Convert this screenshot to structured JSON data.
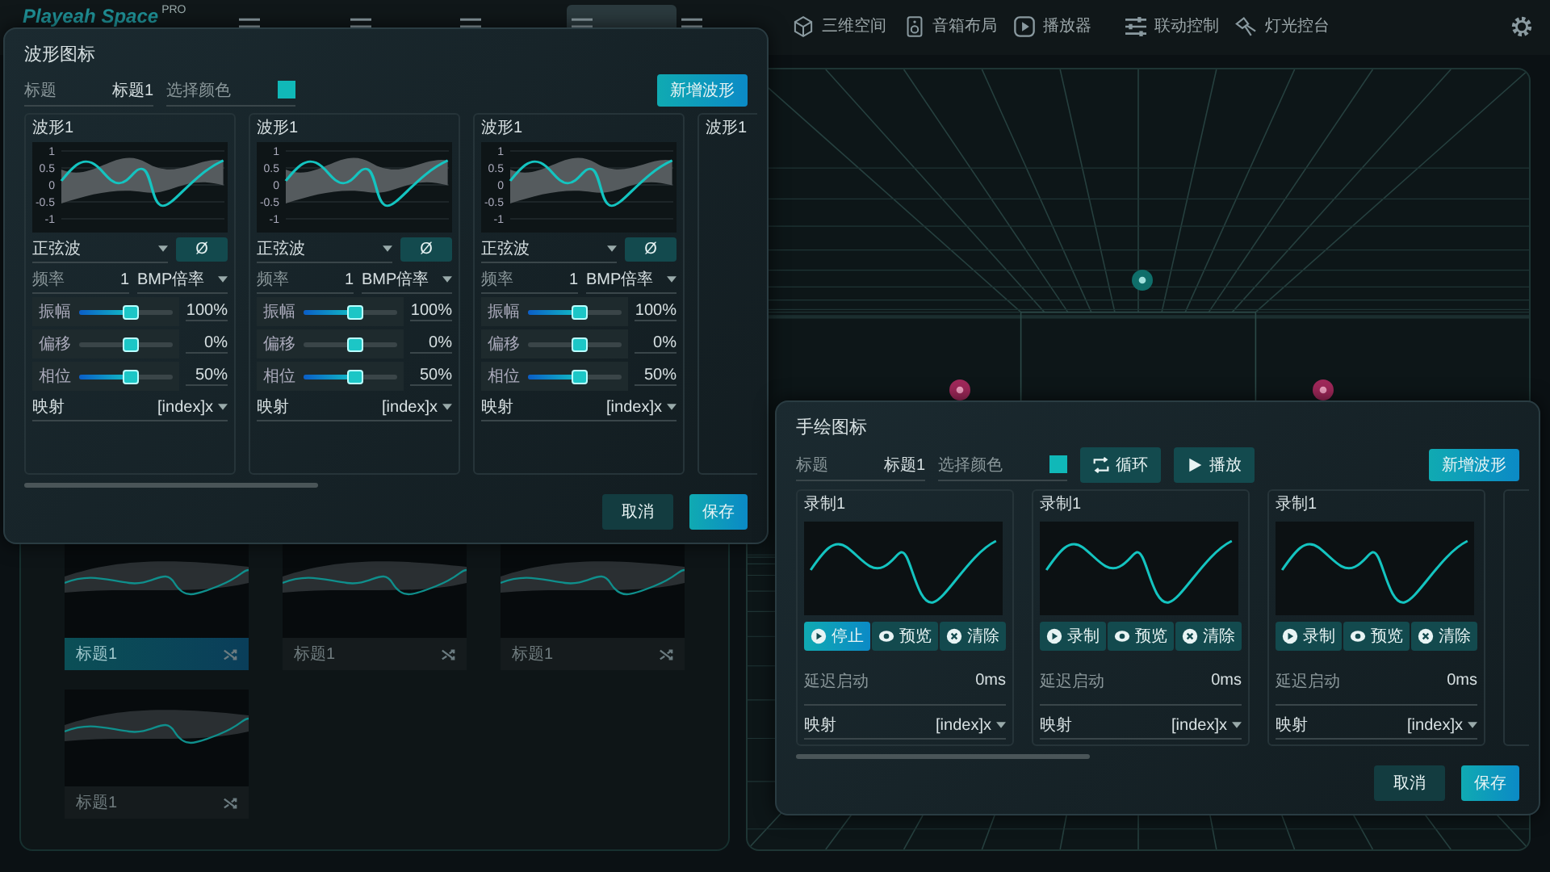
{
  "top_bar": {
    "logo": "Playeah Space",
    "logo_badge": "PRO",
    "nav": [
      {
        "selected": false
      },
      {
        "selected": false
      },
      {
        "selected": false
      },
      {
        "selected": true
      },
      {
        "selected": false
      },
      {
        "label": "三维空间",
        "selected": false
      },
      {
        "label": "音箱布局",
        "selected": false
      },
      {
        "label": "播放器",
        "selected": false
      },
      {
        "label": "联动控制",
        "selected": false
      },
      {
        "label": "灯光控台",
        "selected": false
      }
    ]
  },
  "library": {
    "items": [
      {
        "title": "标题1",
        "selected": true
      },
      {
        "title": "标题1",
        "selected": false
      },
      {
        "title": "标题1",
        "selected": false
      },
      {
        "title": "标题1",
        "selected": false
      }
    ]
  },
  "wave_dialog": {
    "title": "波形图标",
    "title_field": {
      "label": "标题",
      "value": "标题1"
    },
    "color_field": {
      "label": "选择颜色",
      "color": "#10b8b8"
    },
    "add_button": "新增波形",
    "cards": [
      {
        "title": "波形1",
        "yticks": [
          "1",
          "0.5",
          "0",
          "-0.5",
          "-1"
        ],
        "wave_type": "正弦波",
        "invert_button": "Ø",
        "freq_label": "频率",
        "freq_value": "1",
        "freq_mode": "BMP倍率",
        "sliders": [
          {
            "label": "振幅",
            "level": 0.55,
            "kind": "fill",
            "reading": "100%"
          },
          {
            "label": "偏移",
            "level": 0.55,
            "kind": "centered",
            "reading": "0%"
          },
          {
            "label": "相位",
            "level": 0.55,
            "kind": "fill",
            "reading": "50%"
          }
        ],
        "map_label": "映射",
        "map_value": "[index]x"
      },
      {
        "title": "波形1",
        "yticks": [
          "1",
          "0.5",
          "0",
          "-0.5",
          "-1"
        ],
        "wave_type": "正弦波",
        "invert_button": "Ø",
        "freq_label": "频率",
        "freq_value": "1",
        "freq_mode": "BMP倍率",
        "sliders": [
          {
            "label": "振幅",
            "level": 0.55,
            "kind": "fill",
            "reading": "100%"
          },
          {
            "label": "偏移",
            "level": 0.55,
            "kind": "centered",
            "reading": "0%"
          },
          {
            "label": "相位",
            "level": 0.55,
            "kind": "fill",
            "reading": "50%"
          }
        ],
        "map_label": "映射",
        "map_value": "[index]x"
      },
      {
        "title": "波形1",
        "yticks": [
          "1",
          "0.5",
          "0",
          "-0.5",
          "-1"
        ],
        "wave_type": "正弦波",
        "invert_button": "Ø",
        "freq_label": "频率",
        "freq_value": "1",
        "freq_mode": "BMP倍率",
        "sliders": [
          {
            "label": "振幅",
            "level": 0.55,
            "kind": "fill",
            "reading": "100%"
          },
          {
            "label": "偏移",
            "level": 0.55,
            "kind": "centered",
            "reading": "0%"
          },
          {
            "label": "相位",
            "level": 0.55,
            "kind": "fill",
            "reading": "50%"
          }
        ],
        "map_label": "映射",
        "map_value": "[index]x"
      },
      {
        "title": "波形1",
        "kind": "partial"
      }
    ],
    "cancel_button": "取消",
    "save_button": "保存"
  },
  "draw_dialog": {
    "title": "手绘图标",
    "title_field": {
      "label": "标题",
      "value": "标题1"
    },
    "color_field": {
      "label": "选择颜色",
      "color": "#10b8b8"
    },
    "loop_button": "循环",
    "play_button": "播放",
    "add_button": "新增波形",
    "cards": [
      {
        "title": "录制1",
        "buttons": [
          {
            "kind": "record",
            "label": "停止",
            "selected": true
          },
          {
            "kind": "preview",
            "label": "预览",
            "selected": false
          },
          {
            "kind": "clear",
            "label": "清除",
            "selected": false
          }
        ],
        "delay_label": "延迟启动",
        "delay_value": "0ms",
        "map_label": "映射",
        "map_value": "[index]x"
      },
      {
        "title": "录制1",
        "buttons": [
          {
            "kind": "record",
            "label": "录制",
            "selected": false
          },
          {
            "kind": "preview",
            "label": "预览",
            "selected": false
          },
          {
            "kind": "clear",
            "label": "清除",
            "selected": false
          }
        ],
        "delay_label": "延迟启动",
        "delay_value": "0ms",
        "map_label": "映射",
        "map_value": "[index]x"
      },
      {
        "title": "录制1",
        "buttons": [
          {
            "kind": "record",
            "label": "录制",
            "selected": false
          },
          {
            "kind": "preview",
            "label": "预览",
            "selected": false
          },
          {
            "kind": "clear",
            "label": "清除",
            "selected": false
          }
        ],
        "delay_label": "延迟启动",
        "delay_value": "0ms",
        "map_label": "映射",
        "map_value": "[index]x"
      },
      {
        "kind": "partial"
      }
    ],
    "cancel_button": "取消",
    "save_button": "保存"
  }
}
